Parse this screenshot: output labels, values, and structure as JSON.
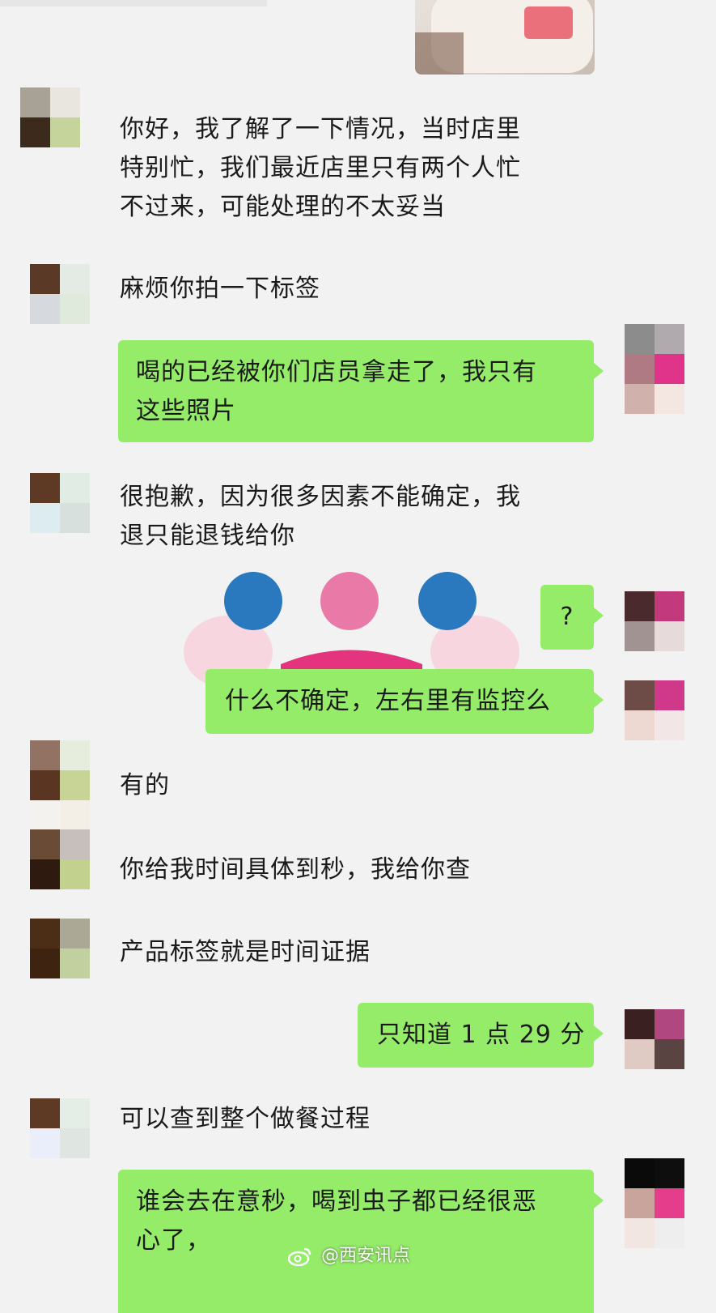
{
  "messages": {
    "m1": {
      "line1": "你好，我了解了一下情况，当时店里",
      "line2": "特别忙，我们最近店里只有两个人忙",
      "line3": "不过来，可能处理的不太妥当"
    },
    "m2": "麻烦你拍一下标签",
    "m3": {
      "line1": "喝的已经被你们店员拿走了，我只有",
      "line2": "这些照片"
    },
    "m4": {
      "line1": "很抱歉，因为很多因素不能确定，我",
      "line2": "退只能退钱给你"
    },
    "m5": "?",
    "m6": "什么不确定，左右里有监控么",
    "m7": "有的",
    "m8": "你给我时间具体到秒，我给你查",
    "m9": "产品标签就是时间证据",
    "m10": "只知道 1 点 29 分",
    "m11": "可以查到整个做餐过程",
    "m12": {
      "line1": "谁会去在意秒，喝到虫子都已经很恶",
      "line2": "心了，"
    }
  },
  "watermark": "@西安讯点",
  "icons": {
    "watermark_icon": "weibo-icon"
  },
  "colors": {
    "background": "#f2f2f2",
    "sent_bubble": "#95ec69",
    "text": "#1a1a1a"
  }
}
